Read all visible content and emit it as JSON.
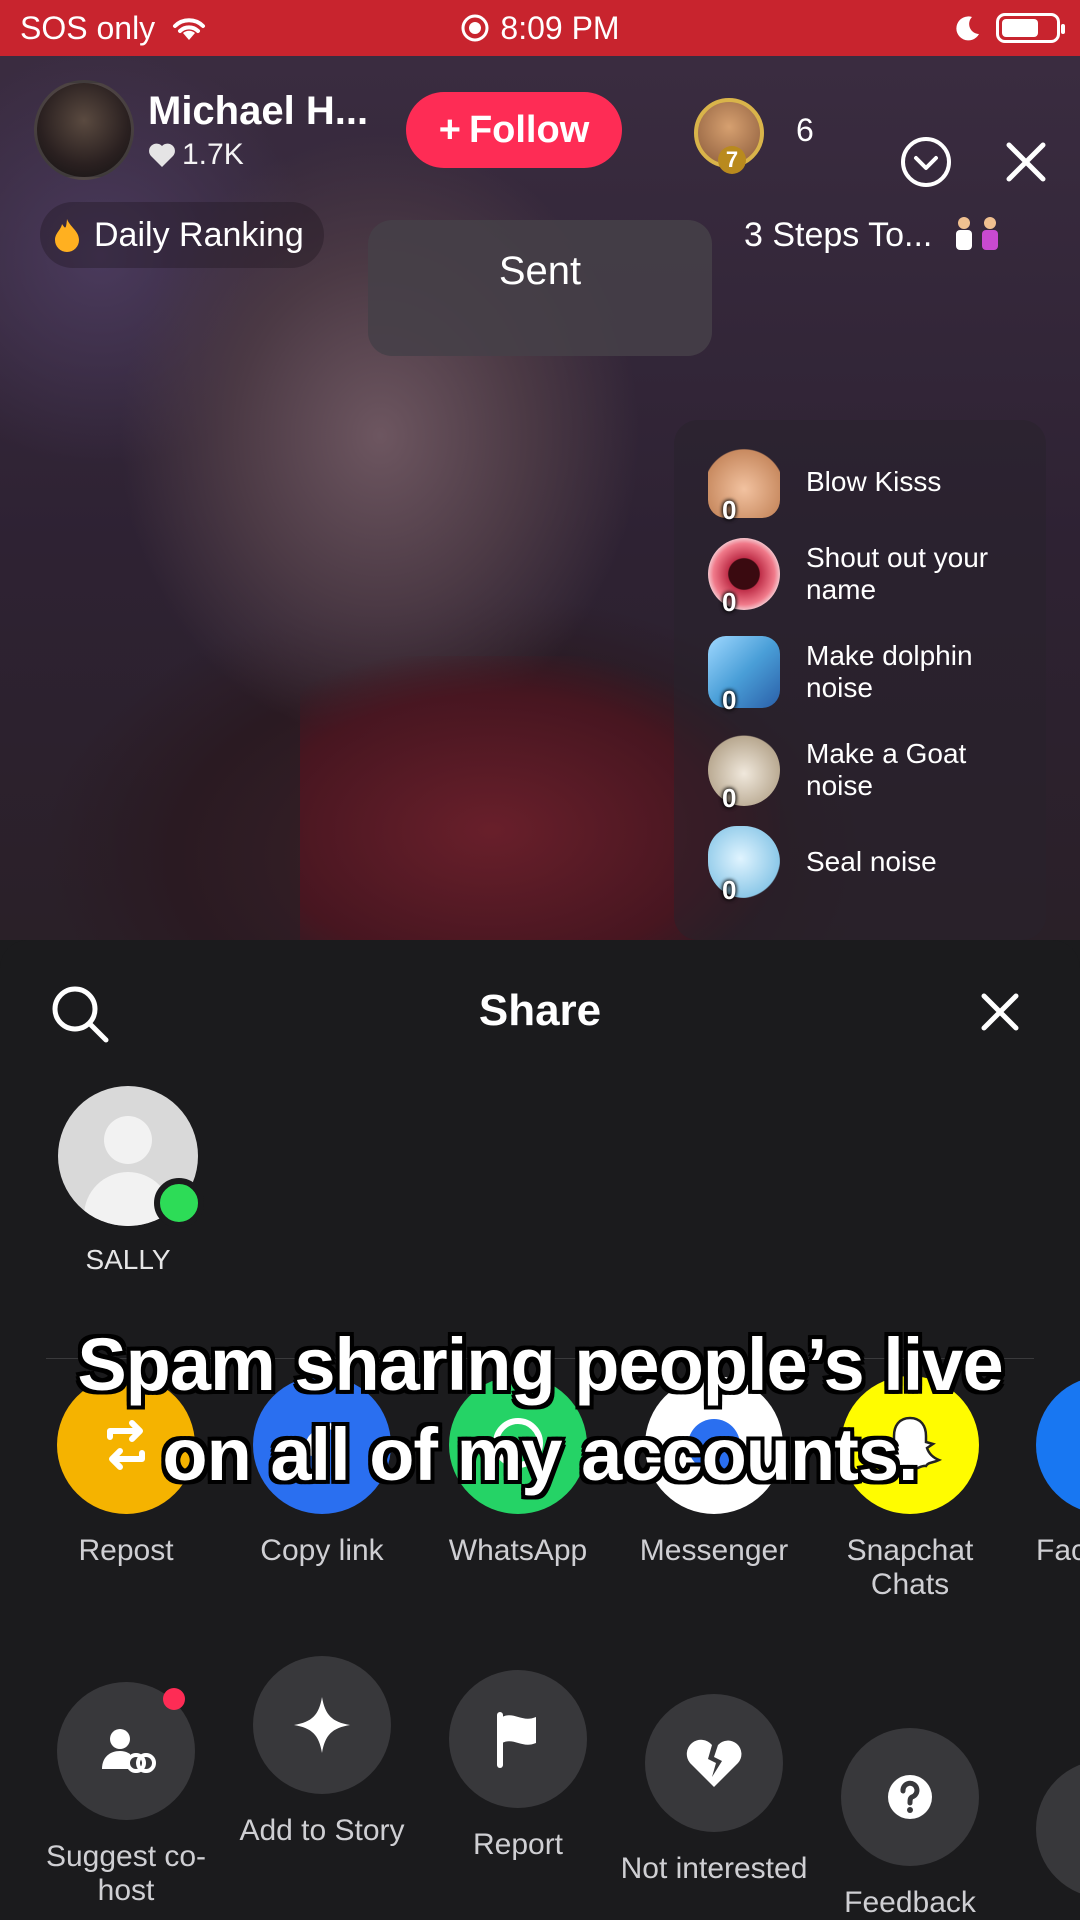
{
  "status_bar": {
    "carrier": "SOS only",
    "time": "8:09 PM",
    "battery_level": 0.7
  },
  "live": {
    "host_name": "Michael H...",
    "host_likes": "1.7K",
    "follow_label": "Follow",
    "viewer_rank": "7",
    "viewer_count": "6",
    "ranking_label": "Daily Ranking",
    "steps_label": "3 Steps To...",
    "toast_text": "Sent",
    "gifts": [
      {
        "label": "Blow Kisss",
        "count": "0",
        "color": "#f2c2a0"
      },
      {
        "label": "Shout out your name",
        "count": "0",
        "color": "#c0304a"
      },
      {
        "label": "Make dolphin noise",
        "count": "0",
        "color": "#4a9fd8"
      },
      {
        "label": "Make a Goat noise",
        "count": "0",
        "color": "#d8cfc0"
      },
      {
        "label": "Seal noise",
        "count": "0",
        "color": "#a8d8f0"
      }
    ]
  },
  "share": {
    "title": "Share",
    "contacts": [
      {
        "name": "SALLY"
      }
    ],
    "apps": [
      {
        "label": "Repost",
        "color": "#f5b300",
        "icon": "repost-icon"
      },
      {
        "label": "Copy link",
        "color": "#2a6ff0",
        "icon": "link-icon"
      },
      {
        "label": "WhatsApp",
        "color": "#25d366",
        "icon": "whatsapp-icon"
      },
      {
        "label": "Messenger",
        "color": "#ffffff",
        "icon": "messenger-icon"
      },
      {
        "label": "Snapchat Chats",
        "color": "#fffc00",
        "icon": "snapchat-icon"
      },
      {
        "label": "Facebook",
        "color": "#1877f2",
        "icon": "facebook-icon"
      }
    ],
    "actions": [
      {
        "label": "Suggest co-host",
        "icon": "cohost-icon"
      },
      {
        "label": "Add to Story",
        "icon": "sparkle-icon"
      },
      {
        "label": "Report",
        "icon": "flag-icon"
      },
      {
        "label": "Not interested",
        "icon": "broken-heart-icon"
      },
      {
        "label": "Feedback",
        "icon": "question-icon"
      }
    ]
  },
  "caption": "Spam sharing people’s live on all of my accounts."
}
